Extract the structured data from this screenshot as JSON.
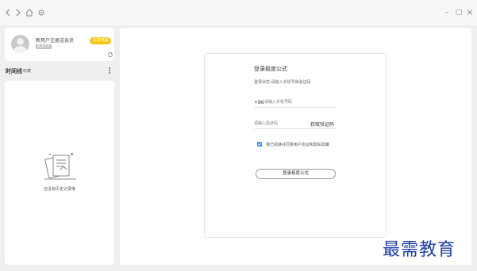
{
  "titlebar": {
    "nav_icons": [
      "back-icon",
      "forward-icon",
      "home-icon",
      "settings-icon"
    ],
    "window_icons": [
      "minimize-icon",
      "maximize-icon",
      "close-icon"
    ],
    "minimize_glyph": "–",
    "maximize_glyph": "□",
    "close_glyph": "×"
  },
  "user": {
    "name": "新用户注册送会员",
    "tag": "普通会员",
    "vip_button": "会员权益"
  },
  "timeline": {
    "title": "时间线",
    "subtitle": "收藏",
    "empty_text": "还没有历史记录哦"
  },
  "login": {
    "title": "登录极度公式",
    "description": "登录状态:请输入手机号和验证码",
    "phone_prefix": "+86",
    "phone_placeholder": "请输入手机号码",
    "code_placeholder": "请输入验证码",
    "get_code": "获取验证码",
    "agreement": "我已阅读并同意用户协议和隐私政策",
    "agreement_checked": true,
    "submit": "登录极度公式"
  },
  "colors": {
    "accent": "#3b8cff",
    "vip": "#f5c518",
    "watermark": "#1f3fa6"
  },
  "watermark": "最需教育"
}
